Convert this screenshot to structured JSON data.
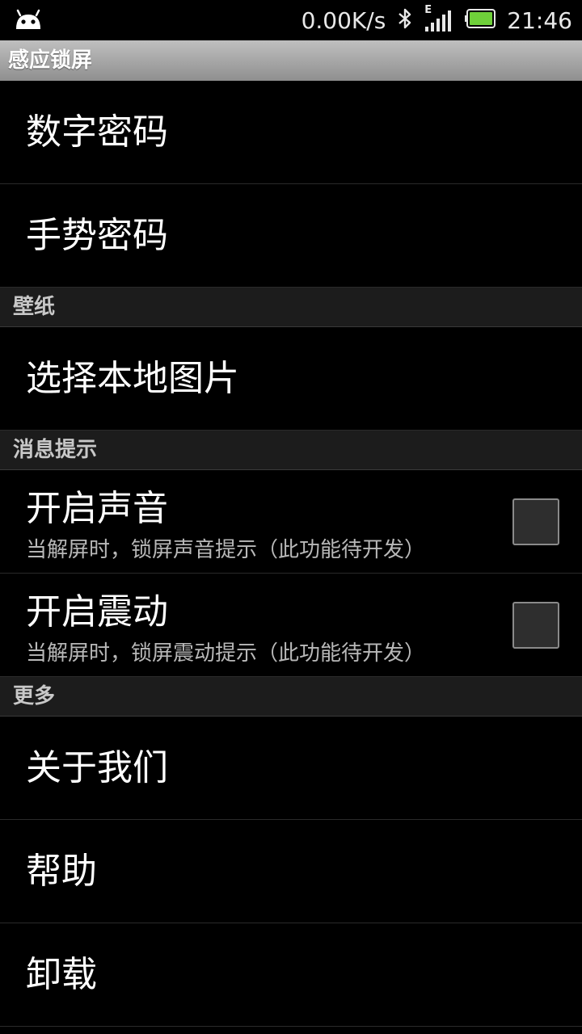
{
  "status_bar": {
    "net_speed": "0.00K/s",
    "network_type": "E",
    "time": "21:46",
    "icons": [
      "android-icon",
      "bluetooth-icon",
      "signal-icon",
      "battery-icon"
    ],
    "battery_color": "#6fd03a"
  },
  "title_bar": {
    "title": "感应锁屏"
  },
  "items": {
    "digit_password": {
      "title": "数字密码"
    },
    "gesture_password": {
      "title": "手势密码"
    },
    "wallpaper_category": {
      "label": "壁纸"
    },
    "local_picture": {
      "title": "选择本地图片"
    },
    "message_category": {
      "label": "消息提示"
    },
    "sound": {
      "title": "开启声音",
      "summary": "当解屏时，锁屏声音提示（此功能待开发）",
      "checked": false
    },
    "vibrate": {
      "title": "开启震动",
      "summary": "当解屏时，锁屏震动提示（此功能待开发）",
      "checked": false
    },
    "more_category": {
      "label": "更多"
    },
    "about": {
      "title": "关于我们"
    },
    "help": {
      "title": "帮助"
    },
    "uninstall": {
      "title": "卸载"
    }
  }
}
